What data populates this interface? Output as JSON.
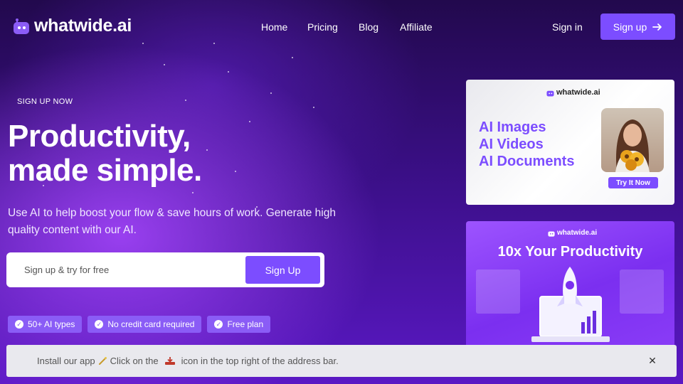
{
  "brand": {
    "name": "whatwide.ai",
    "accent": "#7c4dff"
  },
  "nav": {
    "links": [
      "Home",
      "Pricing",
      "Blog",
      "Affiliate"
    ],
    "signin": "Sign in",
    "signup": "Sign up"
  },
  "hero": {
    "eyebrow": "SIGN UP NOW",
    "headline_line1": "Productivity,",
    "headline_line2": "made simple.",
    "subtext": "Use AI to help boost your flow & save hours of work. Generate high quality content with our AI.",
    "email_placeholder": "Sign up & try for free",
    "submit": "Sign Up",
    "badges": [
      "50+ AI types",
      "No credit card required",
      "Free plan"
    ]
  },
  "promo_card_1": {
    "brand": "whatwide.ai",
    "items": [
      "AI Images",
      "AI Videos",
      "AI Documents"
    ],
    "cta": "Try It Now"
  },
  "promo_card_2": {
    "brand": "whatwide.ai",
    "title": "10x Your Productivity"
  },
  "notice": {
    "text_before": "Install our app",
    "text_middle": "Click on the",
    "text_after": "icon in the top right of the address bar.",
    "wand_icon": "magic-wand-icon",
    "install_icon": "install-icon"
  }
}
